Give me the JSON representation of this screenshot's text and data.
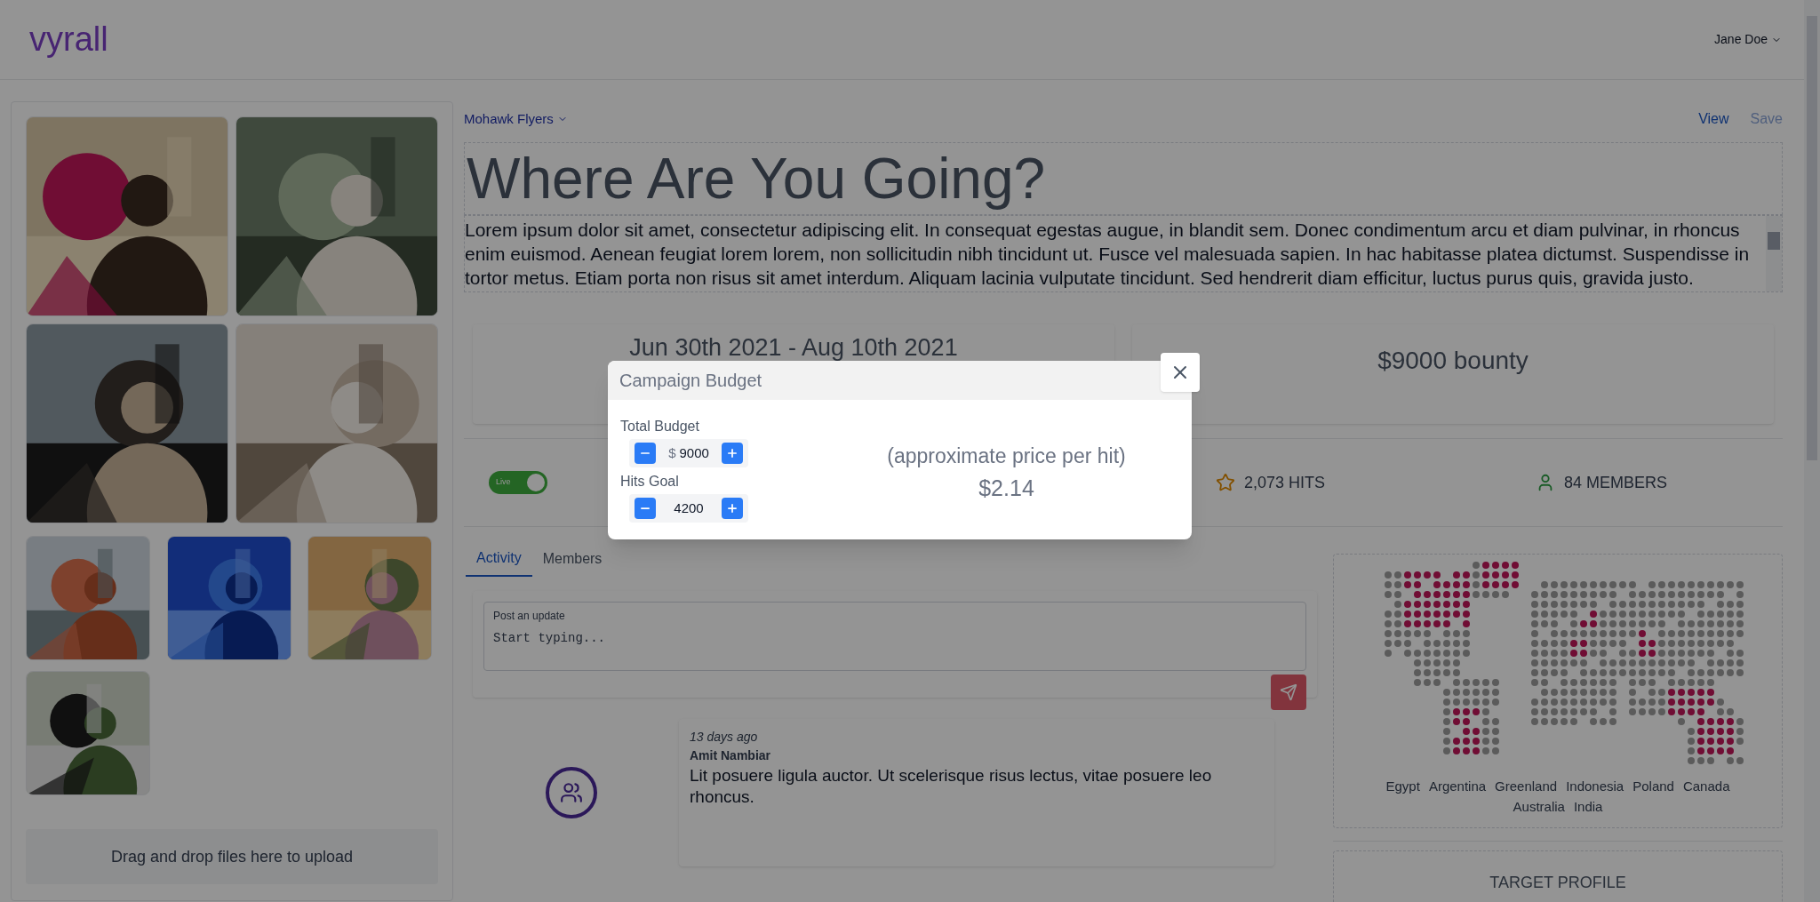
{
  "header": {
    "logo": "vyrall",
    "user": "Jane Doe"
  },
  "uploader": {
    "hint": "Drag and drop files here to upload"
  },
  "campaign": {
    "group": "Mohawk Flyers",
    "actions": [
      {
        "label": "View",
        "disabled": false
      },
      {
        "label": "Save",
        "disabled": true
      }
    ],
    "title": "Where Are You Going?",
    "description": "Lorem ipsum dolor sit amet, consectetur adipiscing elit. In consequat egestas augue, in blandit sem. Donec condimentum arcu et diam pulvinar, in rhoncus enim euismod. Aenean feugiat lorem lorem, non sollicitudin nibh tincidunt ut. Fusce vel malesuada sapien. In hac habitasse platea dictumst. Suspendisse in tortor metus. Etiam porta non risus sit amet interdum. Aliquam lacinia vulputate tincidunt. Sed hendrerit diam efficitur, luctus purus quis, gravida justo.",
    "dates": "Jun 30th 2021 - Aug 10th 2021",
    "bounty": "$9000 bounty",
    "live": {
      "label": "Live",
      "on": true
    },
    "stats": [
      {
        "kind": "hits",
        "text": "2,073 HITS"
      },
      {
        "kind": "members",
        "text": "84 MEMBERS"
      }
    ]
  },
  "tabs": [
    {
      "label": "Activity",
      "selected": true
    },
    {
      "label": "Members",
      "selected": false
    }
  ],
  "composer": {
    "label": "Post an update",
    "placeholder": "Start typing..."
  },
  "activity": [
    {
      "time": "13 days ago",
      "author": "Amit Nambiar",
      "text": "Lit posuere ligula auctor. Ut scelerisque risus lectus, vitae posuere leo rhoncus."
    }
  ],
  "map": {
    "countries": [
      "Egypt",
      "Argentina",
      "Greenland",
      "Indonesia",
      "Poland",
      "Canada",
      "Australia",
      "India"
    ]
  },
  "target_profile": {
    "title": "TARGET PROFILE"
  },
  "modal": {
    "title": "Campaign Budget",
    "fields": [
      {
        "label": "Total Budget",
        "prefix": "$",
        "value": "9000"
      },
      {
        "label": "Hits Goal",
        "value": "4200"
      }
    ],
    "price_caption": "(approximate price per hit)",
    "price": "$2.14"
  }
}
